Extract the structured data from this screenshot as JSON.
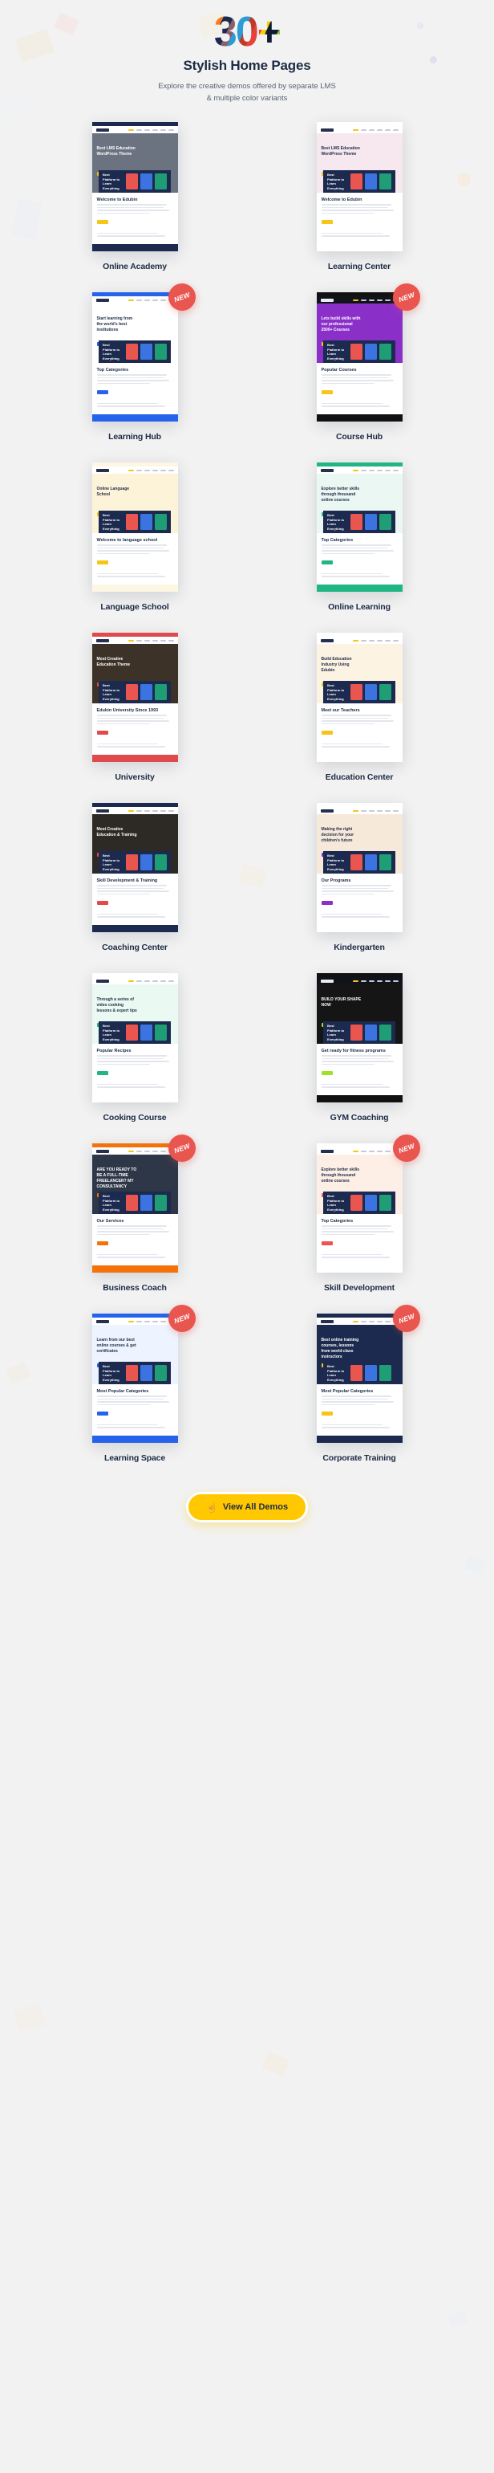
{
  "header": {
    "count": "30+",
    "title": "Stylish Home Pages",
    "subtitle_line1": "Explore the creative demos offered by separate LMS",
    "subtitle_line2": "& multiple color variants"
  },
  "badge": {
    "new_label": "NEW"
  },
  "colors": {
    "page_background": "#f2f2f2",
    "heading": "#1d2b45",
    "body_text": "#5a6372",
    "badge_red": "#e8564f",
    "cta_yellow": "#ffc800",
    "navy": "#1b2a4e"
  },
  "demos": [
    {
      "label": "Online Academy",
      "is_new": false,
      "topbar": "#1b2a4e",
      "hero_bg": "#6b7280",
      "hero_text": "Best LMS Education WordPress Theme",
      "accent": "#f5c518",
      "body_heading": "Welcome to Edubin",
      "dark_nav": false
    },
    {
      "label": "Learning Center",
      "is_new": false,
      "topbar": "#ffffff",
      "hero_bg": "#f7e7ee",
      "hero_text": "Best LMS Education WordPress Theme",
      "accent": "#f5c518",
      "body_heading": "Welcome to Edubin",
      "dark_nav": false
    },
    {
      "label": "Learning Hub",
      "is_new": true,
      "topbar": "#2563eb",
      "hero_bg": "#ffffff",
      "hero_text": "Start learning from the world's best institutions",
      "accent": "#2563eb",
      "body_heading": "Top Categories",
      "dark_nav": false
    },
    {
      "label": "Course Hub",
      "is_new": true,
      "topbar": "#111111",
      "hero_bg": "#8b2fc9",
      "hero_text": "Lets build skills with our professional 2500+ Courses",
      "accent": "#f5c518",
      "body_heading": "Popular Courses",
      "dark_nav": true
    },
    {
      "label": "Language School",
      "is_new": false,
      "topbar": "#fdf6e3",
      "hero_bg": "#fdf3d8",
      "hero_text": "Online Language School",
      "accent": "#f5c518",
      "body_heading": "Welcome to language school",
      "dark_nav": false
    },
    {
      "label": "Online Learning",
      "is_new": false,
      "topbar": "#20b582",
      "hero_bg": "#eaf7f3",
      "hero_text": "Explore better skills through thousand online courses",
      "accent": "#20b582",
      "body_heading": "Top Categories",
      "dark_nav": false
    },
    {
      "label": "University",
      "is_new": false,
      "topbar": "#e04a4a",
      "hero_bg": "#3c3228",
      "hero_text": "Most Creative Education Theme",
      "accent": "#e04a4a",
      "body_heading": "Edubin University Since 1993",
      "dark_nav": false
    },
    {
      "label": "Education Center",
      "is_new": false,
      "topbar": "#ffffff",
      "hero_bg": "#fdf3e3",
      "hero_text": "Build Education Industry Using Edubin",
      "accent": "#f5c518",
      "body_heading": "Meet our Teachers",
      "dark_nav": false
    },
    {
      "label": "Coaching Center",
      "is_new": false,
      "topbar": "#1b2a4e",
      "hero_bg": "#2d2a26",
      "hero_text": "Most Creative Education & Training",
      "accent": "#e04a4a",
      "body_heading": "Skill Development & Training",
      "dark_nav": false
    },
    {
      "label": "Kindergarten",
      "is_new": false,
      "topbar": "#ffffff",
      "hero_bg": "#f7e9da",
      "hero_text": "Making the right decision for your children's future",
      "accent": "#8b2fc9",
      "body_heading": "Our Programs",
      "dark_nav": false
    },
    {
      "label": "Cooking Course",
      "is_new": false,
      "topbar": "#ffffff",
      "hero_bg": "#eafaf2",
      "hero_text": "Through a series of video cooking lessons & expert tips",
      "accent": "#20b582",
      "body_heading": "Popular Recipes",
      "dark_nav": false
    },
    {
      "label": "GYM Coaching",
      "is_new": false,
      "topbar": "#111111",
      "hero_bg": "#151515",
      "hero_text": "BUILD YOUR SHAPE NOW",
      "accent": "#9ee02a",
      "body_heading": "Get ready for fitness programs",
      "dark_nav": true
    },
    {
      "label": "Business Coach",
      "is_new": true,
      "topbar": "#f4720b",
      "hero_bg": "#2e3748",
      "hero_text": "ARE YOU READY TO BE A FULL-TIME FREELANCER? MY CONSULTANCY",
      "accent": "#f4720b",
      "body_heading": "Our Services",
      "dark_nav": false
    },
    {
      "label": "Skill Development",
      "is_new": true,
      "topbar": "#ffffff",
      "hero_bg": "#fdeee6",
      "hero_text": "Explore better skills through thousand online courses",
      "accent": "#e8564f",
      "body_heading": "Top Categories",
      "dark_nav": false
    },
    {
      "label": "Learning Space",
      "is_new": true,
      "topbar": "#2563eb",
      "hero_bg": "#eef4ff",
      "hero_text": "Learn from our best online courses & get certificates",
      "accent": "#2563eb",
      "body_heading": "Most Popular Categories",
      "dark_nav": false
    },
    {
      "label": "Corporate Training",
      "is_new": true,
      "topbar": "#1b2a4e",
      "hero_bg": "#1b2a4e",
      "hero_text": "Best online training courses, lessons from world-class instructors",
      "accent": "#f5c518",
      "body_heading": "Most Popular Categories",
      "dark_nav": false
    }
  ],
  "cta": {
    "label": "View All Demos",
    "icon": "pointing-hand-icon"
  }
}
